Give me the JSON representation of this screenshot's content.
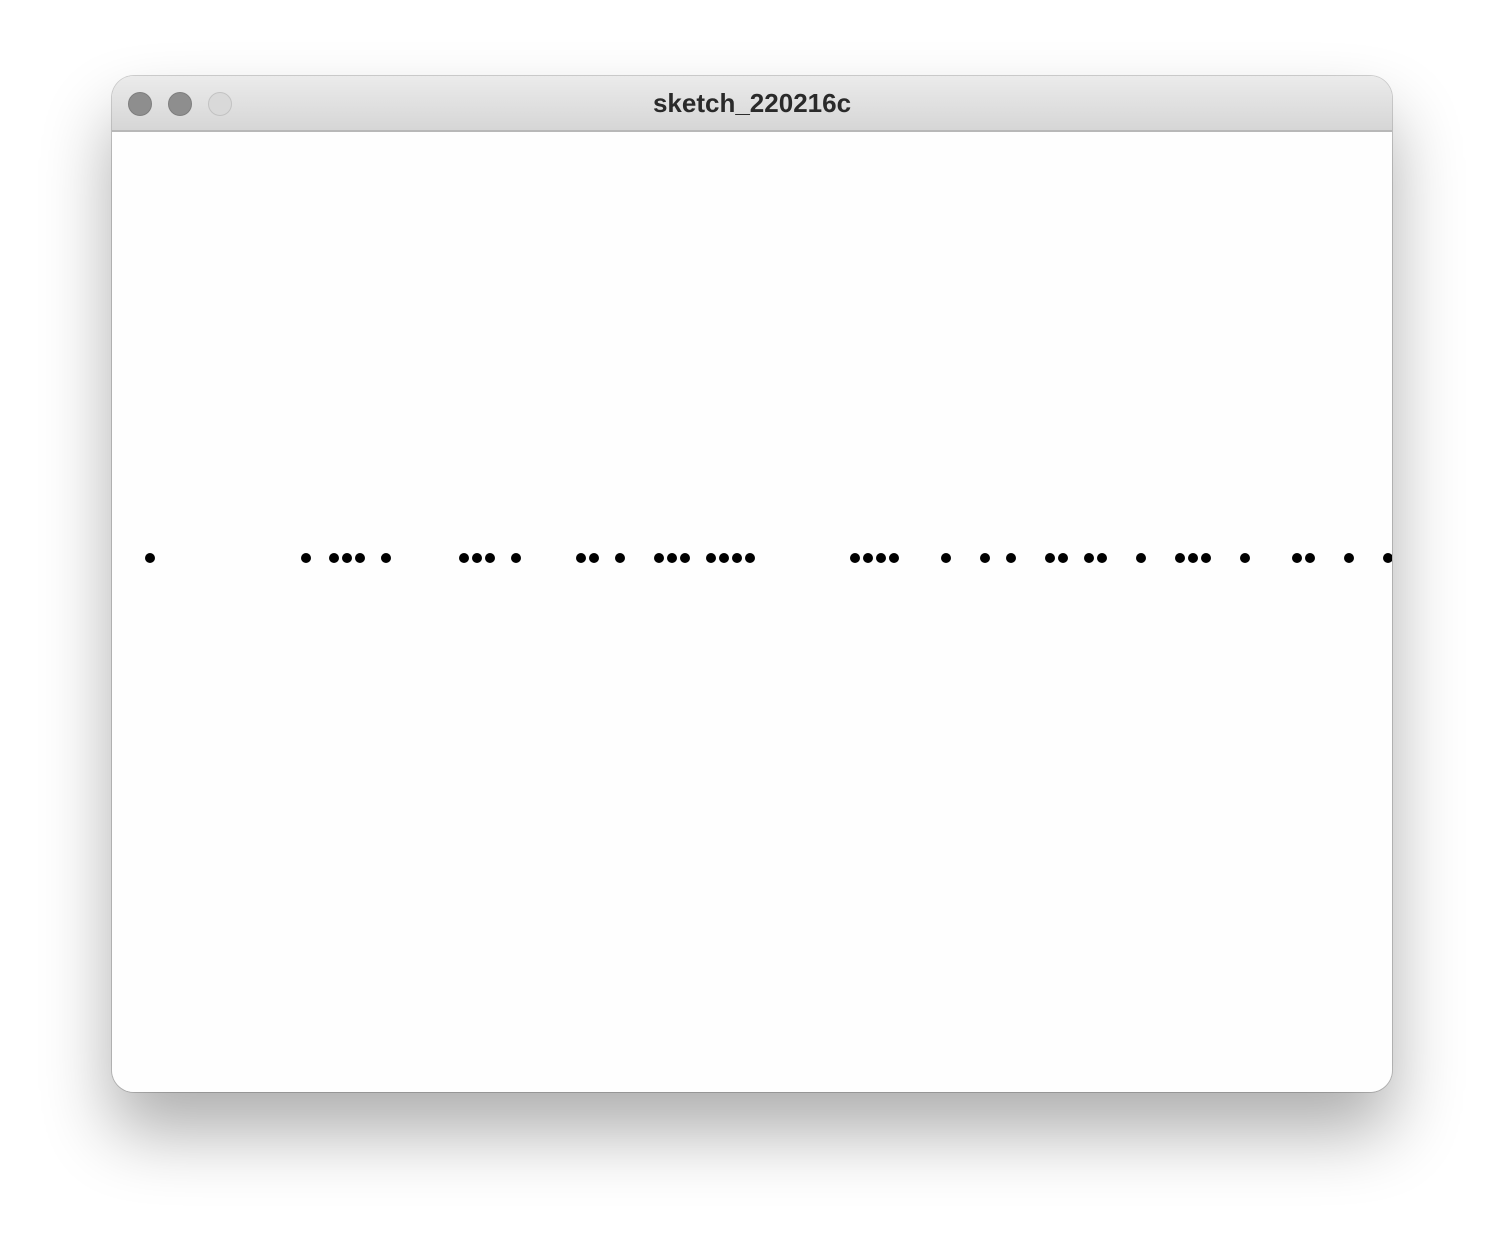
{
  "window": {
    "title": "sketch_220216c"
  },
  "window_controls": [
    {
      "name": "close-button",
      "color": "#8e8e8e"
    },
    {
      "name": "minimize-button",
      "color": "#8e8e8e"
    },
    {
      "name": "zoom-button",
      "color": "#d9d9d9"
    }
  ],
  "sketch": {
    "dot_color": "#000000",
    "background": "#fefefe"
  }
}
